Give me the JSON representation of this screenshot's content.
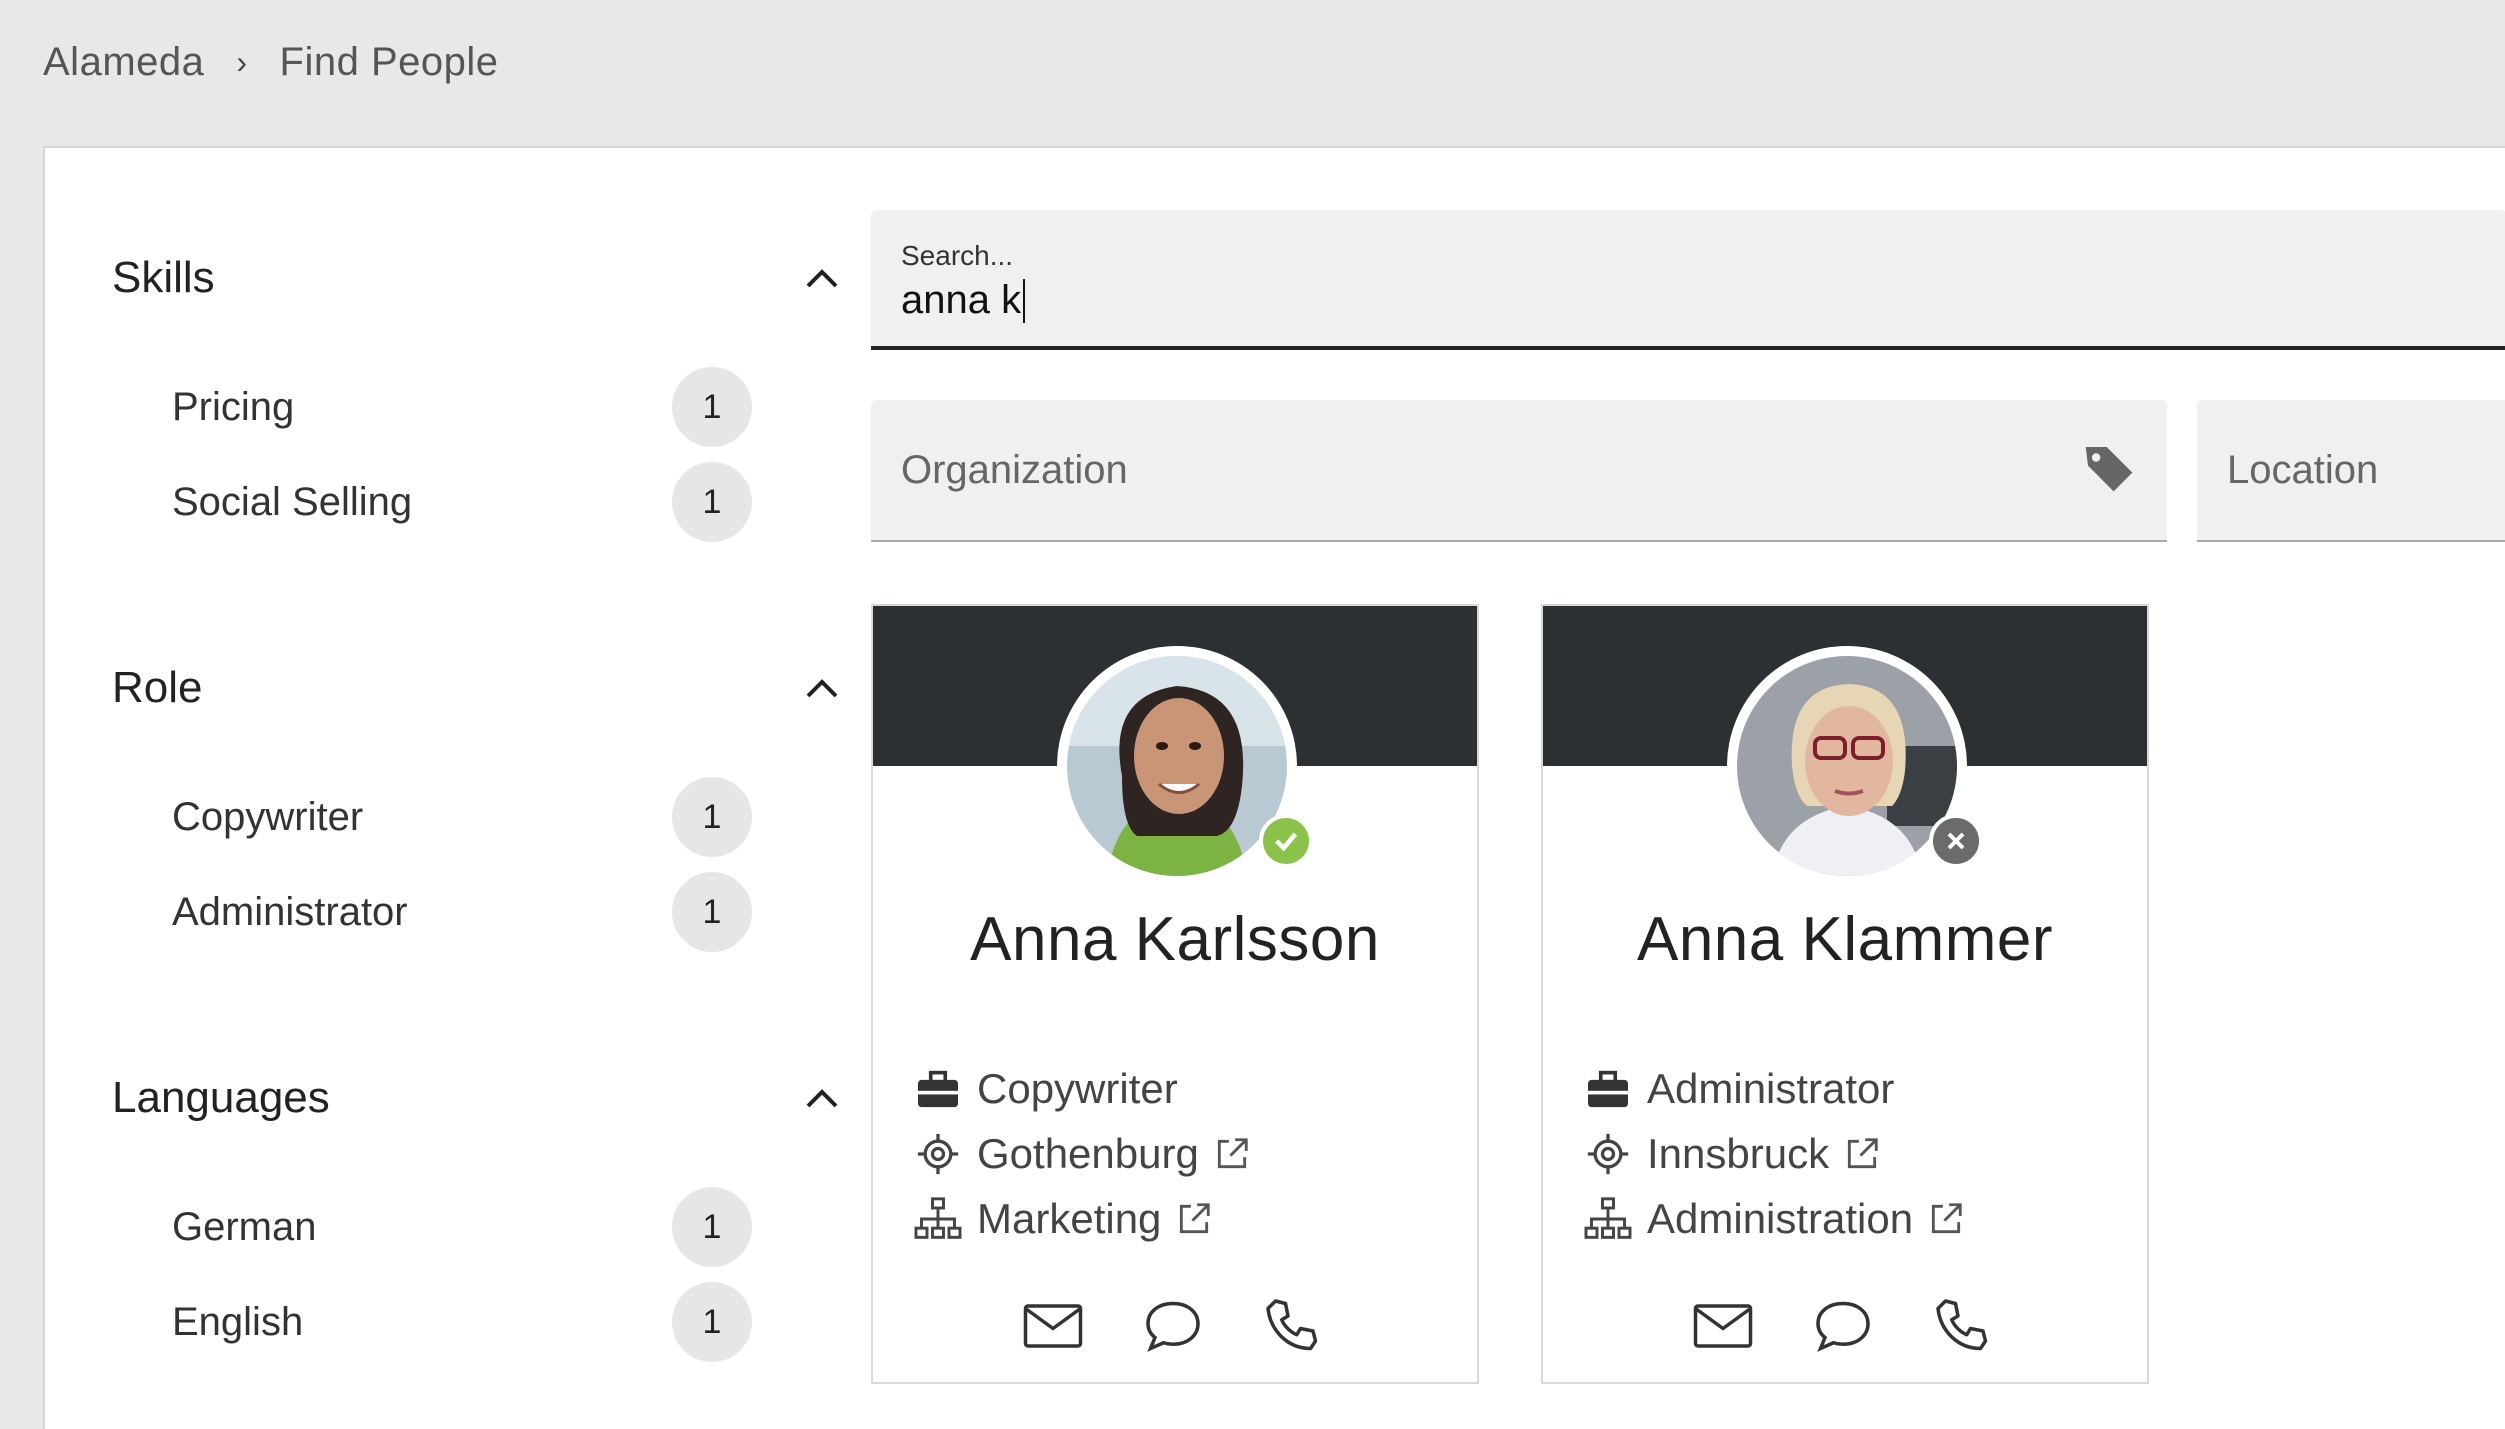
{
  "breadcrumb": {
    "root": "Alameda",
    "separator": "›",
    "current": "Find People"
  },
  "facets": [
    {
      "title": "Skills",
      "items": [
        {
          "label": "Pricing",
          "count": "1"
        },
        {
          "label": "Social Selling",
          "count": "1"
        }
      ]
    },
    {
      "title": "Role",
      "items": [
        {
          "label": "Copywriter",
          "count": "1"
        },
        {
          "label": "Administrator",
          "count": "1"
        }
      ]
    },
    {
      "title": "Languages",
      "items": [
        {
          "label": "German",
          "count": "1"
        },
        {
          "label": "English",
          "count": "1"
        }
      ]
    }
  ],
  "search": {
    "placeholder": "Search...",
    "value": "anna k"
  },
  "filters": {
    "organization": "Organization",
    "location": "Location"
  },
  "people": [
    {
      "name": "Anna Karlsson",
      "role": "Copywriter",
      "location": "Gothenburg",
      "department": "Marketing",
      "status": "online",
      "status_color": "#8bc34a"
    },
    {
      "name": "Anna Klammer",
      "role": "Administrator",
      "location": "Innsbruck",
      "department": "Administration",
      "status": "offline",
      "status_color": "#6b6b6b"
    }
  ],
  "colors": {
    "banner": "#2b3035",
    "badge": "#e6e6e6",
    "field": "#f0f0f0"
  },
  "icons": [
    "chevron-up-icon",
    "tag-icon",
    "briefcase-icon",
    "location-target-icon",
    "org-chart-icon",
    "external-link-icon",
    "mail-icon",
    "chat-icon",
    "phone-icon"
  ]
}
